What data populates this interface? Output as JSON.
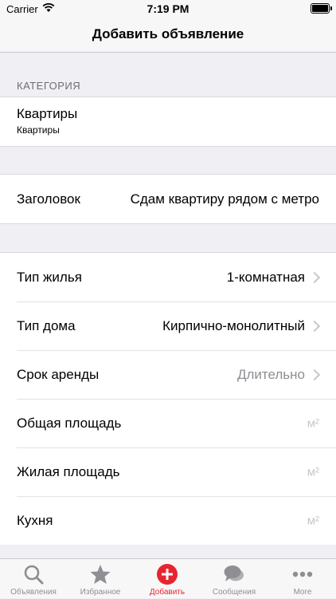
{
  "status": {
    "carrier": "Carrier",
    "time": "7:19 PM"
  },
  "nav": {
    "title": "Добавить объявление"
  },
  "category": {
    "header": "КАТЕГОРИЯ",
    "title": "Квартиры",
    "subtitle": "Квартиры"
  },
  "headline": {
    "label": "Заголовок",
    "value": "Сдам квартиру рядом с метро"
  },
  "fields": [
    {
      "label": "Тип жилья",
      "value": "1-комнатная"
    },
    {
      "label": "Тип дома",
      "value": "Кирпично-монолитный"
    },
    {
      "label": "Срок аренды",
      "value": "Длительно"
    },
    {
      "label": "Общая площадь",
      "unit": "м²"
    },
    {
      "label": "Жилая площадь",
      "unit": "м²"
    },
    {
      "label": "Кухня",
      "unit": "м²"
    }
  ],
  "tabs": [
    {
      "label": "Объявления",
      "icon": "search-icon"
    },
    {
      "label": "Избранное",
      "icon": "star-icon"
    },
    {
      "label": "Добавить",
      "icon": "add-icon",
      "active": true
    },
    {
      "label": "Сообщения",
      "icon": "chat-icon"
    },
    {
      "label": "More",
      "icon": "more-icon"
    }
  ],
  "colors": {
    "accent": "#e8242f",
    "inactive": "#8e8e93"
  }
}
